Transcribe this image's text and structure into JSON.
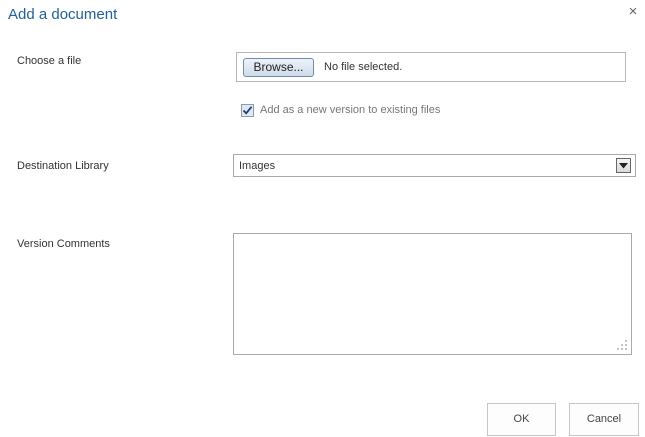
{
  "dialog": {
    "title": "Add a document",
    "close_glyph": "×"
  },
  "choose_file": {
    "label": "Choose a file",
    "browse_label": "Browse...",
    "status_text": "No file selected."
  },
  "new_version": {
    "label": "Add as a new version to existing files",
    "checked": true
  },
  "destination": {
    "label": "Destination Library",
    "selected": "Images"
  },
  "version_comments": {
    "label": "Version Comments",
    "value": ""
  },
  "footer": {
    "ok_label": "OK",
    "cancel_label": "Cancel"
  },
  "icons": {
    "close": "close-icon",
    "checkmark": "checkmark-icon",
    "dropdown": "dropdown-arrow-icon",
    "resize": "resize-grip-icon"
  },
  "colors": {
    "title": "#1f5fa6",
    "checkbox_fill": "#dfe7f2",
    "checkmark": "#1d3f77"
  }
}
